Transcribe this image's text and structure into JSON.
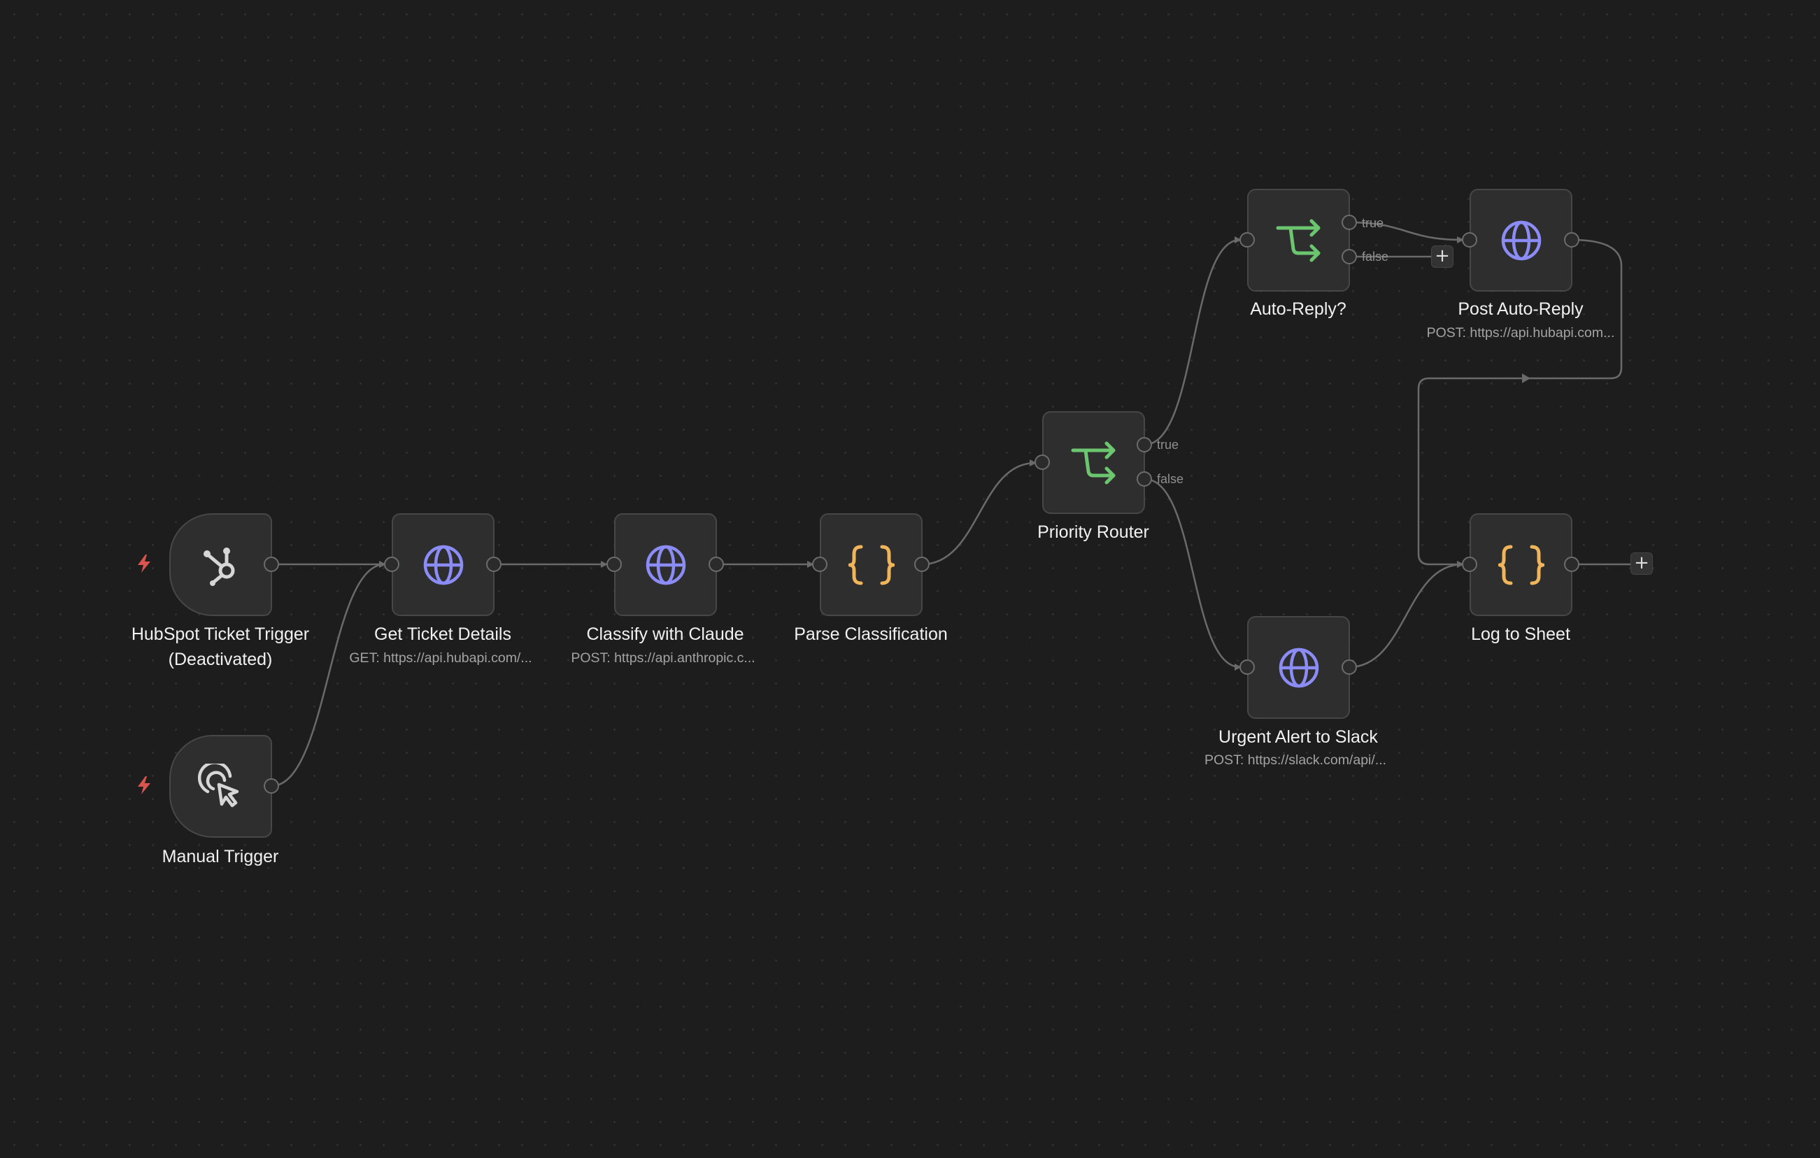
{
  "nodes": {
    "hubspot_trigger": {
      "label_line1": "HubSpot Ticket Trigger",
      "label_line2": "(Deactivated)",
      "icon": "hubspot-icon"
    },
    "manual_trigger": {
      "label": "Manual Trigger",
      "icon": "pointer-click-icon"
    },
    "get_ticket": {
      "label": "Get Ticket Details",
      "subtitle": "GET: https://api.hubapi.com/...",
      "icon": "globe-icon"
    },
    "classify": {
      "label": "Classify with Claude",
      "subtitle": "POST: https://api.anthropic.c...",
      "icon": "globe-icon"
    },
    "parse": {
      "label": "Parse Classification",
      "icon": "code-braces-icon"
    },
    "router": {
      "label": "Priority Router",
      "icon": "branch-icon",
      "true_label": "true",
      "false_label": "false"
    },
    "auto_reply": {
      "label": "Auto-Reply?",
      "icon": "branch-icon",
      "true_label": "true",
      "false_label": "false"
    },
    "post_reply": {
      "label": "Post Auto-Reply",
      "subtitle": "POST: https://api.hubapi.com...",
      "icon": "globe-icon"
    },
    "slack": {
      "label": "Urgent Alert to Slack",
      "subtitle": "POST: https://slack.com/api/...",
      "icon": "globe-icon"
    },
    "log": {
      "label": "Log to Sheet",
      "icon": "code-braces-icon"
    }
  },
  "add_button_label": "+",
  "colors": {
    "background": "#1d1d1d",
    "node_fill": "#2e2e2e",
    "http_icon": "#8b8cf5",
    "if_icon": "#6cc66f",
    "code_icon": "#f0b45a",
    "trigger_bolt": "#d9534f",
    "edge": "#6a6a6a"
  }
}
